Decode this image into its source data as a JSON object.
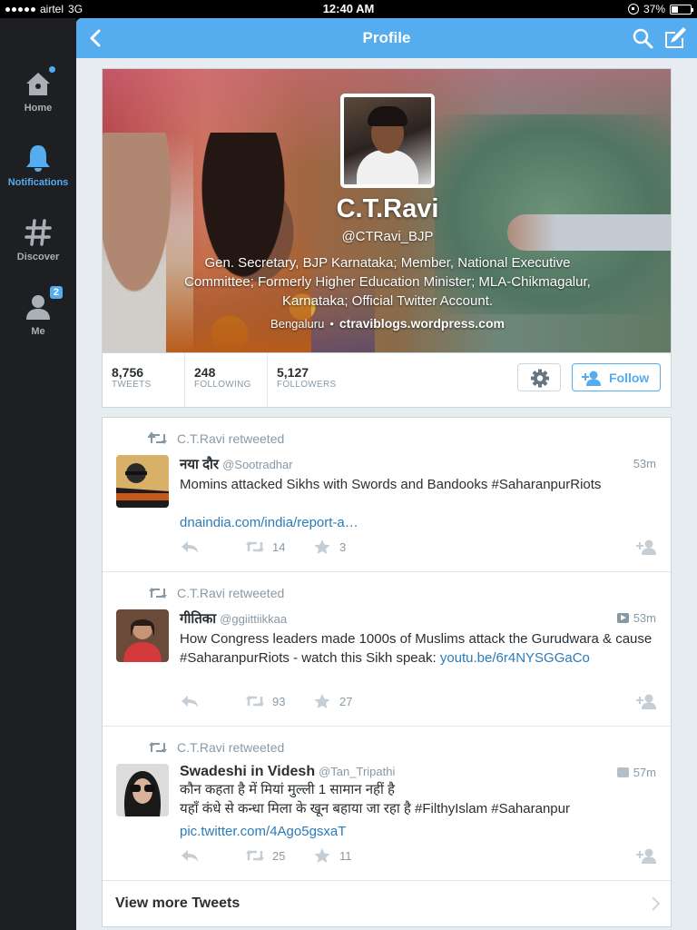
{
  "status_bar": {
    "carrier": "airtel",
    "network": "3G",
    "time": "12:40 AM",
    "battery": "37%",
    "battery_level": 0.37
  },
  "sidebar": {
    "items": [
      {
        "label": "Home",
        "icon": "home-icon",
        "active": false,
        "dot": true
      },
      {
        "label": "Notifications",
        "icon": "bell-icon",
        "active": true
      },
      {
        "label": "Discover",
        "icon": "hashtag-icon",
        "active": false
      },
      {
        "label": "Me",
        "icon": "person-icon",
        "active": false,
        "badge": "2"
      }
    ]
  },
  "navbar": {
    "title": "Profile"
  },
  "profile": {
    "name": "C.T.Ravi",
    "handle": "@CTRavi_BJP",
    "bio": "Gen. Secretary, BJP Karnataka; Member, National Executive Committee; Formerly Higher Education Minister; MLA-Chikmagalur, Karnataka; Official Twitter Account.",
    "location": "Bengaluru",
    "separator": "•",
    "url": "ctraviblogs.wordpress.com"
  },
  "stats": {
    "tweets": {
      "value": "8,756",
      "label": "TWEETS"
    },
    "following": {
      "value": "248",
      "label": "FOLLOWING"
    },
    "followers": {
      "value": "5,127",
      "label": "FOLLOWERS"
    },
    "follow_label": "Follow"
  },
  "tweets": [
    {
      "retweeted_by": "C.T.Ravi retweeted",
      "name": "नया दौर",
      "handle": "@Sootradhar",
      "time": "53m",
      "media": "",
      "text": "Momins attacked Sikhs with Swords and Bandooks #SaharanpurRiots",
      "link": "dnaindia.com/india/report-a…",
      "retweets": "14",
      "favorites": "3"
    },
    {
      "retweeted_by": "C.T.Ravi retweeted",
      "name": "गीतिका",
      "handle": "@ggiittiikkaa",
      "time": "53m",
      "media": "video",
      "text": "How Congress leaders made 1000s of Muslims attack the Gurudwara & cause #SaharanpurRiots - watch this Sikh speak: ",
      "link": "youtu.be/6r4NYSGGaCo",
      "retweets": "93",
      "favorites": "27"
    },
    {
      "retweeted_by": "C.T.Ravi retweeted",
      "name": "Swadeshi in Videsh",
      "handle": "@Tan_Tripathi",
      "time": "57m",
      "media": "photo",
      "text_line1": "कौन कहता है में मियां मुल्ली 1 सामान नहीं है",
      "text_line2": "यहाँ कंधे से कन्धा मिला के खून बहाया जा रहा है #FilthyIslam #Saharanpur",
      "link": "pic.twitter.com/4Ago5gsxaT",
      "retweets": "25",
      "favorites": "11"
    }
  ],
  "view_more": "View more Tweets",
  "colors": {
    "accent": "#55acee",
    "sidebar_bg": "#1d1f22",
    "link": "#2b7bb9",
    "muted": "#8899a6"
  }
}
